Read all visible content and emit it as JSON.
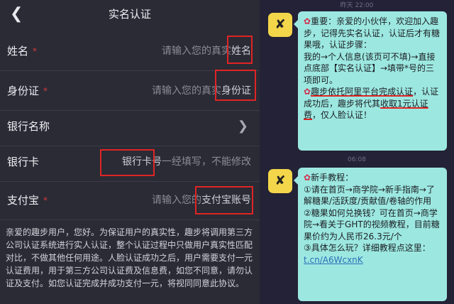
{
  "form": {
    "title": "实名认证",
    "back_icon": "chevron-left-icon",
    "rows": [
      {
        "label": "姓名",
        "placeholder_prefix": "请输入您的真实",
        "placeholder_highlight": "姓名"
      },
      {
        "label": "身份证",
        "placeholder_prefix": "请输入您的真实",
        "placeholder_highlight": "身份证"
      },
      {
        "label": "银行名称",
        "chevron_icon": "chevron-right-icon"
      },
      {
        "label": "银行卡",
        "placeholder_highlight": "银行卡号",
        "placeholder_suffix": "一经填写，不能修改"
      },
      {
        "label": "支付宝",
        "placeholder_prefix": "请输入您的",
        "placeholder_highlight": "支付宝账号"
      }
    ],
    "required_mark": "*",
    "notice": "亲爱的趣步用户，您好。为保证用户的真实性，趣步将调用第三方公司认证系统进行实人认证，整个认证过程中只做用户真实性匹配对比，不做其他任何用途。人脸认证成功之后，用户需要支付一元认证费用，用于第三方公司认证费及信息费，如您不同意，请勿认证及支付。如您认证完成并成功支付一元，将视同同意此协议。"
  },
  "chat": {
    "time1": "昨天 22:00",
    "time2": "06:08",
    "avatar_icon": "app-logo-icon",
    "msg1": {
      "p1": "重要：亲爱的小伙伴，欢迎加入趣步，记得先实名认证，认证后才有糖果哦，认证步骤：",
      "p2": "我的→个人信息(该页可不填)→直接点底部【实名认证】→填带*号的三项即可。",
      "p3_underlined": "趣步依托阿里平台完成认证",
      "p3_rest": "，认证成功后，趣步将代其",
      "p3_underlined2": "收取1元认证费",
      "p3_end": "，仅人脸认证！"
    },
    "msg2": {
      "title": "新手教程：",
      "item1": "请在首页→商学院→新手指南→了解糖果/活跃度/贡献值/卷轴的作用",
      "item2": "糖果如何兑换钱？可在首页→商学院→看关于GHT的视频教程，目前糖果价约为人民币26.3元/个",
      "item3_text": "具体怎么玩？详细教程点这里：",
      "item3_link": "t.cn/A6WcxnK"
    }
  }
}
